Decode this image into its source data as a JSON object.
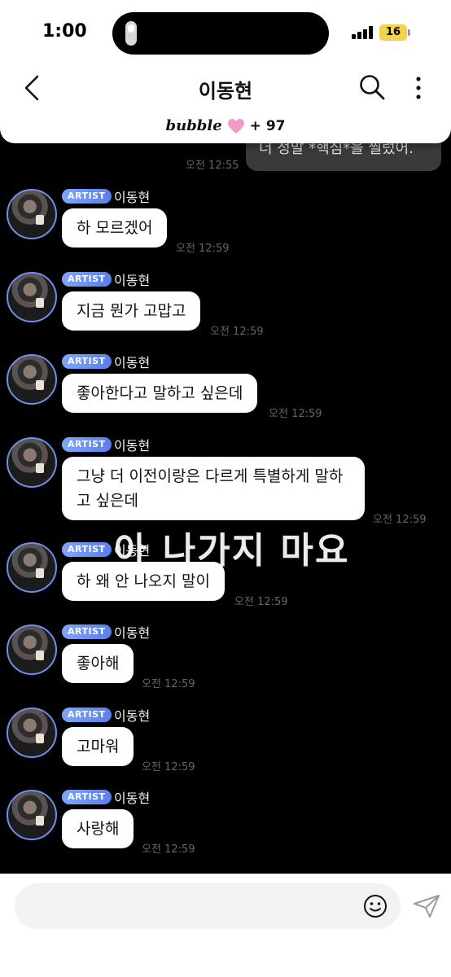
{
  "status": {
    "time": "1:00",
    "battery": "16"
  },
  "header": {
    "title": "이동현"
  },
  "banner": {
    "logo": "bubble",
    "count": "+ 97"
  },
  "my_message": {
    "text": "더 정말 *핵심*을 찔렀어.",
    "time": "오전 12:55"
  },
  "messages": [
    {
      "badge": "ARTIST",
      "name": "이동현",
      "text": "하 모르겠어",
      "time": "오전 12:59"
    },
    {
      "badge": "ARTIST",
      "name": "이동현",
      "text": "지금 뭔가 고맙고",
      "time": "오전 12:59"
    },
    {
      "badge": "ARTIST",
      "name": "이동현",
      "text": "좋아한다고 말하고 싶은데",
      "time": "오전 12:59"
    },
    {
      "badge": "ARTIST",
      "name": "이동현",
      "text": "그냥 더 이전이랑은 다르게 특별하게 말하고 싶은데",
      "time": "오전 12:59"
    },
    {
      "badge": "ARTIST",
      "name": "이동현",
      "text": "하 왜 안 나오지 말이",
      "time": "오전 12:59"
    },
    {
      "badge": "ARTIST",
      "name": "이동현",
      "text": "좋아해",
      "time": "오전 12:59"
    },
    {
      "badge": "ARTIST",
      "name": "이동현",
      "text": "고마워",
      "time": "오전 12:59"
    },
    {
      "badge": "ARTIST",
      "name": "이동현",
      "text": "사랑해",
      "time": "오전 12:59"
    }
  ],
  "overlay_caption": "아 나가지 마요",
  "colors": {
    "artist_badge": "#6f8fe8",
    "heart": "#f29ac7",
    "battery": "#f0d34a",
    "chat_bg": "#000000"
  },
  "icons": [
    "back-icon",
    "search-icon",
    "more-icon",
    "heart-icon",
    "emoji-icon",
    "send-icon"
  ]
}
